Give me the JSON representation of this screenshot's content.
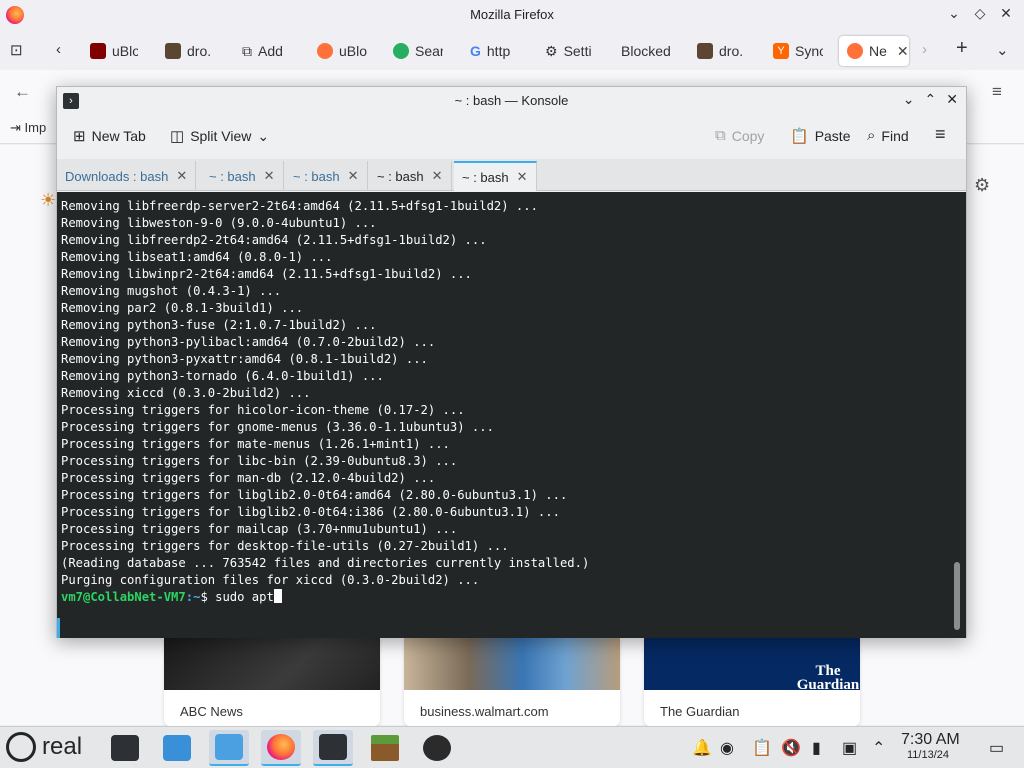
{
  "firefox": {
    "window_title": "Mozilla Firefox",
    "tabs": [
      {
        "label": "uBlo",
        "fav_color": "#800000"
      },
      {
        "label": "dro.",
        "fav_color": "#5a4632"
      },
      {
        "label": "Add",
        "fav_color": "#555555"
      },
      {
        "label": "uBlo",
        "fav_color": "#ff7139"
      },
      {
        "label": "Sear",
        "fav_color": "#27ae60"
      },
      {
        "label": "http",
        "fav_color": "#4285f4"
      },
      {
        "label": "Setti",
        "fav_color": "#555555"
      },
      {
        "label": "Blocked",
        "fav_color": ""
      },
      {
        "label": "dro.",
        "fav_color": "#5a4632"
      },
      {
        "label": "Sync",
        "fav_color": "#ff6600"
      },
      {
        "label": "Ne",
        "fav_color": "#ff7139"
      }
    ],
    "bookmarks_item": "Imp",
    "cards": [
      {
        "label": "ABC News"
      },
      {
        "label": "business.walmart.com"
      },
      {
        "label": "The Guardian",
        "logo": "The Guardian"
      }
    ]
  },
  "konsole": {
    "title": "~ : bash — Konsole",
    "toolbar": {
      "new_tab": "New Tab",
      "split_view": "Split View",
      "copy": "Copy",
      "paste": "Paste",
      "find": "Find"
    },
    "tabs": [
      {
        "label": "Downloads : bash"
      },
      {
        "label": "~ : bash"
      },
      {
        "label": "~ : bash"
      },
      {
        "label": "~ : bash"
      },
      {
        "label": "~ : bash"
      }
    ],
    "terminal_lines": [
      "Removing libfreerdp-server2-2t64:amd64 (2.11.5+dfsg1-1build2) ...",
      "Removing libweston-9-0 (9.0.0-4ubuntu1) ...",
      "Removing libfreerdp2-2t64:amd64 (2.11.5+dfsg1-1build2) ...",
      "Removing libseat1:amd64 (0.8.0-1) ...",
      "Removing libwinpr2-2t64:amd64 (2.11.5+dfsg1-1build2) ...",
      "Removing mugshot (0.4.3-1) ...",
      "Removing par2 (0.8.1-3build1) ...",
      "Removing python3-fuse (2:1.0.7-1build2) ...",
      "Removing python3-pylibacl:amd64 (0.7.0-2build2) ...",
      "Removing python3-pyxattr:amd64 (0.8.1-1build2) ...",
      "Removing python3-tornado (6.4.0-1build1) ...",
      "Removing xiccd (0.3.0-2build2) ...",
      "Processing triggers for hicolor-icon-theme (0.17-2) ...",
      "Processing triggers for gnome-menus (3.36.0-1.1ubuntu3) ...",
      "Processing triggers for mate-menus (1.26.1+mint1) ...",
      "Processing triggers for libc-bin (2.39-0ubuntu8.3) ...",
      "Processing triggers for man-db (2.12.0-4build2) ...",
      "Processing triggers for libglib2.0-0t64:amd64 (2.80.0-6ubuntu3.1) ...",
      "Processing triggers for libglib2.0-0t64:i386 (2.80.0-6ubuntu3.1) ...",
      "Processing triggers for mailcap (3.70+nmu1ubuntu1) ...",
      "Processing triggers for desktop-file-utils (0.27-2build1) ...",
      "(Reading database ... 763542 files and directories currently installed.)",
      "Purging configuration files for xiccd (0.3.0-2build2) ..."
    ],
    "prompt": {
      "user_host": "vm7@CollabNet-VM7",
      "path": ":~",
      "symbol": "$ ",
      "command": "sudo apt"
    }
  },
  "taskbar": {
    "start_label": "real",
    "apps": [
      "settings-app",
      "discover-app",
      "file-manager-app",
      "firefox-app",
      "konsole-app",
      "minecraft-app",
      "obs-app"
    ],
    "clock_time": "7:30 AM",
    "clock_date": "11/13/24"
  },
  "colors": {
    "terminal_bg": "#232627",
    "prompt_user": "#2bd463",
    "prompt_path": "#4aa8e8",
    "accent": "#3daee9"
  }
}
